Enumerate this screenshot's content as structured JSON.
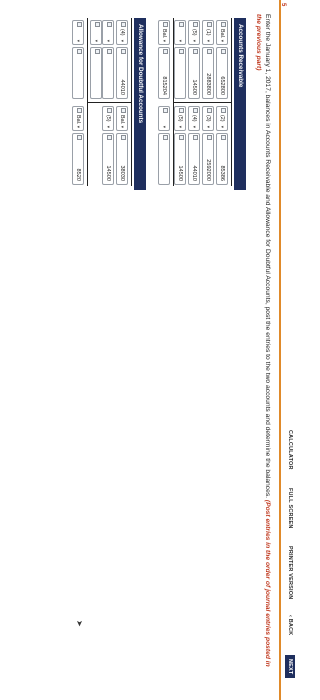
{
  "toolbar": {
    "next": "NEXT",
    "back": "‹ BACK",
    "printer": "PRINTER VERSION",
    "fullscreen": "FULL SCREEN",
    "calculator": "CALCULATOR",
    "corner_mark": "5"
  },
  "instructions": {
    "text": "Enter the January 1, 2017, balances in Accounts Receivable and Allowance for Doubtful Accounts, post the entries to the two accounts and determine the balances.",
    "highlight": "(Post entries in the order of journal entries posted in the previous part)"
  },
  "accounts_receivable": {
    "title": "Accounts Receivable",
    "left": [
      {
        "label": "Bal.",
        "value": "652800"
      },
      {
        "label": "(1)",
        "value": "2883800"
      },
      {
        "label": "(5)",
        "value": "14500"
      },
      {
        "label": "",
        "value": ""
      },
      {
        "label": "Bal.",
        "value": "815204"
      }
    ],
    "right": [
      {
        "label": "(2)",
        "value": "85386"
      },
      {
        "label": "(3)",
        "value": "2592000"
      },
      {
        "label": "(4)",
        "value": "44010"
      },
      {
        "label": "(5)",
        "value": "14500"
      }
    ]
  },
  "allowance": {
    "title": "Allowance for Doubtful Accounts",
    "left": [
      {
        "label": "(4)",
        "value": "44010"
      },
      {
        "label": "",
        "value": ""
      },
      {
        "label": "",
        "value": ""
      }
    ],
    "right": [
      {
        "label": "Bal.",
        "value": "38030"
      },
      {
        "label": "(5)",
        "value": "14500"
      },
      {
        "label": "Bal.",
        "value": "8520"
      }
    ]
  }
}
